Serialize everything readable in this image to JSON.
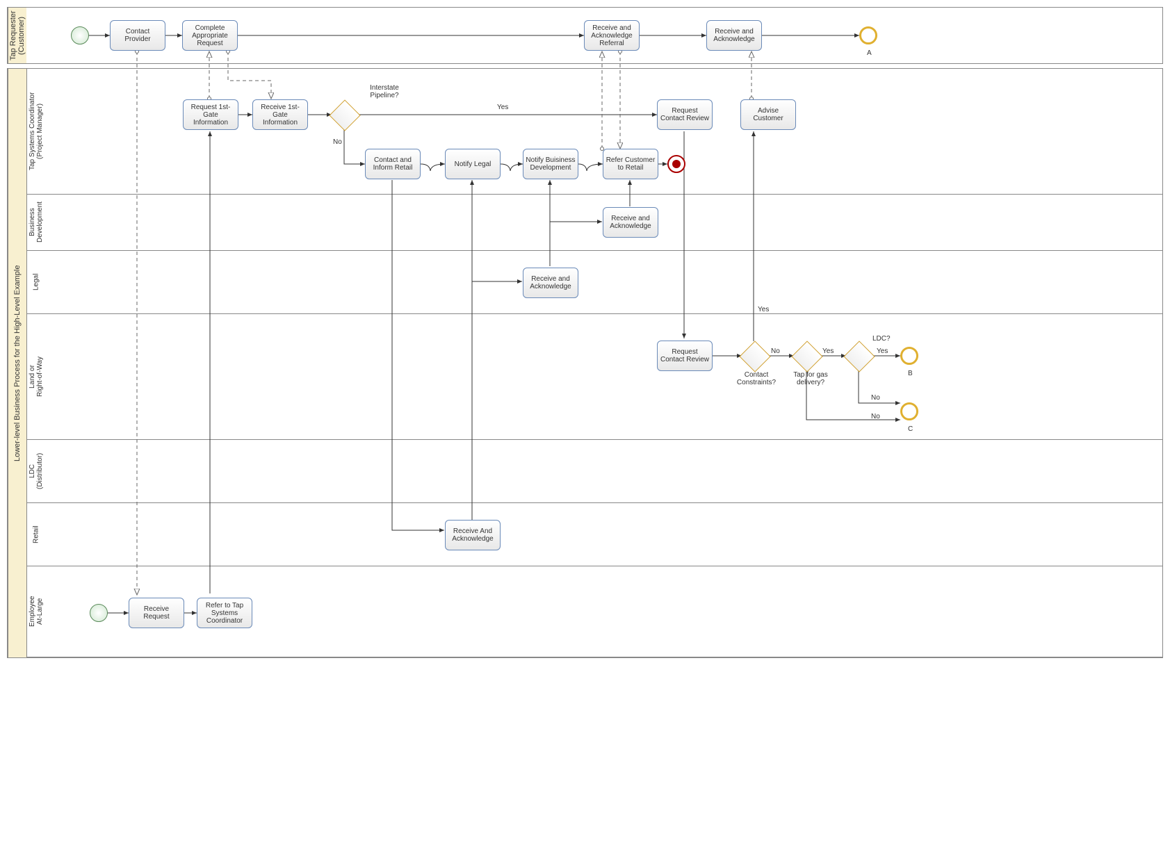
{
  "pool1": {
    "title": "Tap Requester\n(Customer)",
    "tasks": {
      "contact_provider": "Contact Provider",
      "complete_request": "Complete Appropriate Request",
      "rec_ack_referral": "Receive and Acknowledge Referral",
      "rec_ack": "Receive and Acknowledge"
    },
    "end_a": "A"
  },
  "pool2": {
    "title": "Lower-level Business Process for the High-Level Example",
    "lanes": {
      "tsc": "Tap Systems Coordinator\n(Project Manager)",
      "bd": "Business\nDevelopment",
      "legal": "Legal",
      "land": "Land or\nRight-of-Way",
      "ldc": "LDC\n(Distributor)",
      "retail": "Retail",
      "emp": "Employee\nAt-Large"
    },
    "tasks": {
      "req_1st_gate": "Request 1st-Gate Information",
      "rec_1st_gate": "Receive 1st-Gate Information",
      "contact_inform_retail": "Contact and Inform Retail",
      "notify_legal": "Notify Legal",
      "notify_bd": "Notify Buisiness Development",
      "refer_cust_retail": "Refer Customer to Retail",
      "request_contact_review": "Request Contact Review",
      "advise_customer": "Advise Customer",
      "bd_rec_ack": "Receive and Acknowledge",
      "legal_rec_ack": "Receive and Acknowledge",
      "land_req_review": "Request Contact Review",
      "retail_rec_ack": "Receive And Acknowledge",
      "emp_rec_req": "Receive Request",
      "emp_refer": "Refer to Tap Systems Coordinator"
    },
    "labels": {
      "interstate": "Interstate\nPipeline?",
      "yes": "Yes",
      "no": "No",
      "contact_constraints": "Contact\nConstraints?",
      "tap_gas": "Tap for gas\ndelivery?",
      "ldc_q": "LDC?",
      "end_b": "B",
      "end_c": "C"
    }
  }
}
